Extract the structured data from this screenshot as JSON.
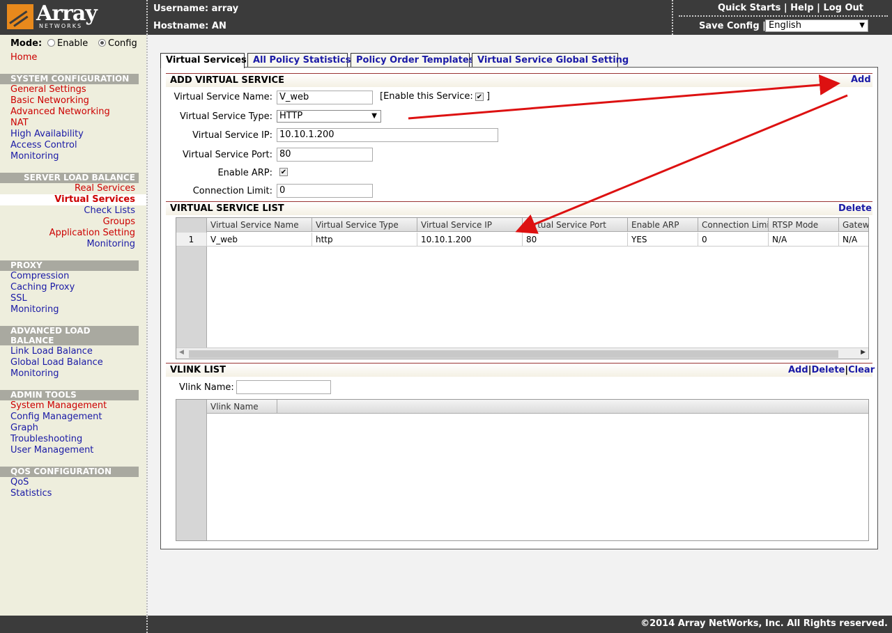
{
  "brand": {
    "name": "Array",
    "sub": "NETWORKS"
  },
  "header": {
    "username_label": "Username:",
    "username": "array",
    "hostname_label": "Hostname:",
    "hostname": "AN",
    "quick_starts": "Quick Starts",
    "help": "Help",
    "logout": "Log Out",
    "save_config": "Save Config",
    "separator": "|",
    "language": "English"
  },
  "sidebar": {
    "mode_label": "Mode:",
    "mode_enable": "Enable",
    "mode_config": "Config",
    "mode_selected": "Config",
    "home": "Home",
    "sections": [
      {
        "title": "SYSTEM CONFIGURATION",
        "items": [
          "General Settings",
          "Basic Networking",
          "Advanced Networking",
          "NAT",
          "High Availability",
          "Access Control",
          "Monitoring"
        ]
      },
      {
        "title": "SERVER LOAD BALANCE",
        "items": [
          "Real Services",
          "Virtual Services",
          "Check Lists",
          "Groups",
          "Application Setting",
          "Monitoring"
        ]
      },
      {
        "title": "PROXY",
        "items": [
          "Compression",
          "Caching Proxy",
          "SSL",
          "Monitoring"
        ]
      },
      {
        "title": "ADVANCED LOAD BALANCE",
        "items": [
          "Link Load Balance",
          "Global Load Balance",
          "Monitoring"
        ]
      },
      {
        "title": "ADMIN TOOLS",
        "items": [
          "System Management",
          "Config Management",
          "Graph",
          "Troubleshooting",
          "User Management"
        ]
      },
      {
        "title": "QOS CONFIGURATION",
        "items": [
          "QoS",
          "Statistics"
        ]
      }
    ],
    "selected_item": "Virtual Services"
  },
  "tabs": [
    "Virtual Services",
    "All Policy Statistics",
    "Policy Order Templates",
    "Virtual Service Global Setting"
  ],
  "add_section": {
    "title": "ADD VIRTUAL SERVICE",
    "add_link": "Add",
    "name_label": "Virtual Service Name:",
    "name_value": "V_web",
    "enable_label": "[Enable this Service:",
    "enable_close": "]",
    "enable_checked": true,
    "type_label": "Virtual Service Type:",
    "type_value": "HTTP",
    "ip_label": "Virtual Service IP:",
    "ip_value": "10.10.1.200",
    "port_label": "Virtual Service Port:",
    "port_value": "80",
    "arp_label": "Enable ARP:",
    "arp_checked": true,
    "conn_label": "Connection Limit:",
    "conn_value": "0"
  },
  "list_section": {
    "title": "VIRTUAL SERVICE LIST",
    "delete_link": "Delete",
    "columns": [
      "Virtual Service Name",
      "Virtual Service Type",
      "Virtual Service IP",
      "Virtual Service Port",
      "Enable ARP",
      "Connection Limit",
      "RTSP Mode",
      "Gatew"
    ],
    "rows": [
      {
        "index": "1",
        "cells": [
          "V_web",
          "http",
          "10.10.1.200",
          "80",
          "YES",
          "0",
          "N/A",
          "N/A"
        ]
      }
    ]
  },
  "vlink_section": {
    "title": "VLINK LIST",
    "add_link": "Add",
    "delete_link": "Delete",
    "clear_link": "Clear",
    "sep": "|",
    "name_label": "Vlink Name:",
    "name_value": "",
    "columns": [
      "Vlink Name"
    ]
  },
  "footer": {
    "copyright": "©2014 Array NetWorks, Inc. All Rights reserved."
  }
}
